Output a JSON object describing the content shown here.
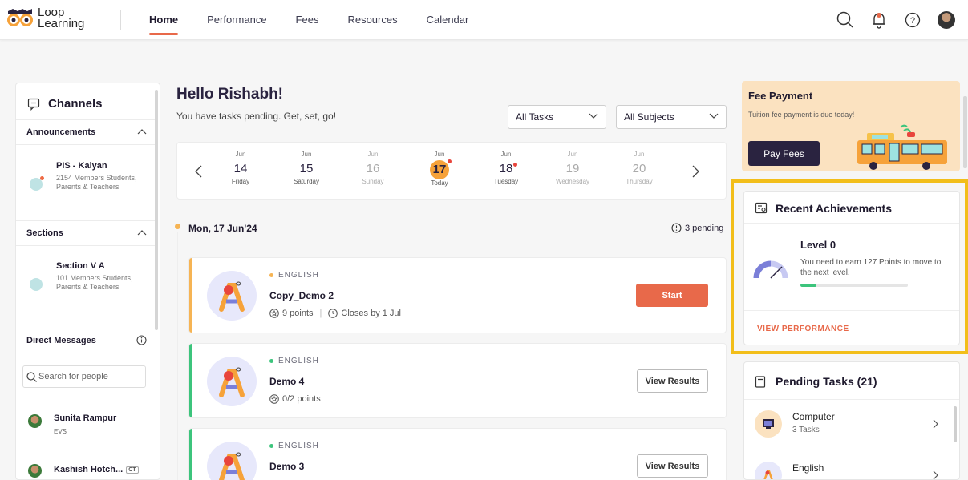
{
  "app": {
    "logo_line1": "Loop",
    "logo_line2": "Learning"
  },
  "nav": {
    "items": [
      {
        "label": "Home",
        "active": true
      },
      {
        "label": "Performance"
      },
      {
        "label": "Fees"
      },
      {
        "label": "Resources"
      },
      {
        "label": "Calendar"
      }
    ],
    "icons": [
      "search-icon",
      "bell-icon",
      "help-icon",
      "profile-avatar"
    ]
  },
  "sidebar": {
    "title": "Channels",
    "announcements": {
      "label": "Announcements",
      "items": [
        {
          "title": "PIS - Kalyan",
          "sub": "2154 Members Students, Parents & Teachers"
        }
      ]
    },
    "sections": {
      "label": "Sections",
      "items": [
        {
          "title": "Section V A",
          "sub": "101 Members Students, Parents & Teachers"
        }
      ]
    },
    "direct_messages": {
      "label": "Direct Messages",
      "search_placeholder": "Search for people",
      "people": [
        {
          "name": "Sunita Rampur",
          "sub": "EVS"
        },
        {
          "name": "Kashish Hotch...",
          "badge": "CT"
        }
      ]
    }
  },
  "main": {
    "greeting": "Hello Rishabh!",
    "subtitle": "You have tasks pending. Get, set, go!",
    "filters": {
      "tasks": "All Tasks",
      "subjects": "All Subjects"
    },
    "calendar": [
      {
        "month": "Jun",
        "day": "14",
        "weekday": "Friday",
        "state": "normal"
      },
      {
        "month": "Jun",
        "day": "15",
        "weekday": "Saturday",
        "state": "normal"
      },
      {
        "month": "Jun",
        "day": "16",
        "weekday": "Sunday",
        "state": "dim"
      },
      {
        "month": "Jun",
        "day": "17",
        "weekday": "Today",
        "state": "today",
        "has_task": true
      },
      {
        "month": "Jun",
        "day": "18",
        "weekday": "Tuesday",
        "state": "normal",
        "has_task": true
      },
      {
        "month": "Jun",
        "day": "19",
        "weekday": "Wednesday",
        "state": "dim"
      },
      {
        "month": "Jun",
        "day": "20",
        "weekday": "Thursday",
        "state": "dim"
      }
    ],
    "date_heading": "Mon, 17 Jun'24",
    "pending_label": "3 pending",
    "tasks": [
      {
        "subject": "ENGLISH",
        "subject_color": "#f6b454",
        "bar_color": "#f6b454",
        "title": "Copy_Demo 2",
        "points": "9 points",
        "closes": "Closes by 1 Jul",
        "action": "Start"
      },
      {
        "subject": "ENGLISH",
        "subject_color": "#3cc47c",
        "bar_color": "#3cc47c",
        "title": "Demo 4",
        "points": "0/2 points",
        "action": "View Results"
      },
      {
        "subject": "ENGLISH",
        "subject_color": "#3cc47c",
        "bar_color": "#3cc47c",
        "title": "Demo 3",
        "action": "View Results"
      }
    ]
  },
  "fee": {
    "title": "Fee Payment",
    "subtitle": "Tuition fee payment is due today!",
    "button": "Pay Fees"
  },
  "achievements": {
    "title": "Recent Achievements",
    "level": "Level 0",
    "description": "You need to earn 127 Points to move to the next level.",
    "progress": 0.15,
    "link": "VIEW PERFORMANCE",
    "highlight_color": "#f2be1a"
  },
  "pending_tasks": {
    "title": "Pending Tasks (21)",
    "items": [
      {
        "subject": "Computer",
        "count": "3 Tasks"
      },
      {
        "subject": "English",
        "count": ""
      }
    ]
  }
}
